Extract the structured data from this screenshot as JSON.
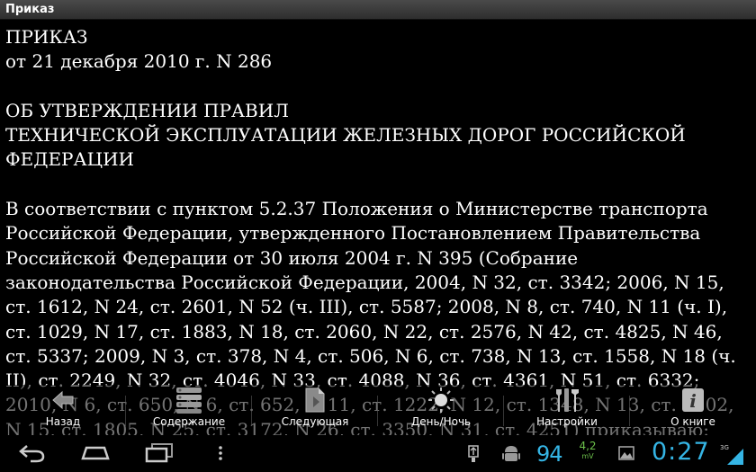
{
  "window": {
    "title": "Приказ"
  },
  "document": {
    "heading1": "ПРИКАЗ",
    "heading2": "от 21 декабря 2010 г. N 286",
    "title_line1": "ОБ УТВЕРЖДЕНИИ ПРАВИЛ",
    "title_line2": "ТЕХНИЧЕСКОЙ ЭКСПЛУАТАЦИИ ЖЕЛЕЗНЫХ ДОРОГ РОССИЙСКОЙ",
    "title_line3": "ФЕДЕРАЦИИ",
    "body": "В соответствии с пунктом 5.2.37 Положения о Министерстве транспорта Российской Федерации, утвержденного Постановлением Правительства Российской Федерации от 30 июля 2004 г. N 395 (Собрание законодательства Российской Федерации, 2004, N 32, ст. 3342; 2006, N 15, ст. 1612, N 24, ст. 2601, N 52 (ч. III), ст. 5587; 2008, N 8, ст. 740, N 11 (ч. I), ст. 1029, N 17, ст. 1883, N 18, ст. 2060, N 22, ст. 2576, N 42, ст. 4825, N 46, ст. 5337; 2009, N 3, ст. 378, N 4, ст. 506, N 6, ст. 738, N 13, ст. 1558, N 18 (ч. II), ст. 2249, N 32, ст. 4046, N 33, ст. 4088, N 36, ст. 4361, N 51, ст. 6332; 2010, N 6, ст. 650, N 6, ст. 652, N 11, ст. 1222, N 12, ст. 1348, N 13, ст. 1502, N 15, ст. 1805, N 25, ст. 3172, N 26, ст. 3350, N 31, ст. 4251) приказываю:"
  },
  "actions": [
    {
      "label": "Назад",
      "icon": "back-icon"
    },
    {
      "label": "Содержание",
      "icon": "contents-icon"
    },
    {
      "label": "Следующая",
      "icon": "next-page-icon"
    },
    {
      "label": "День/Ночь",
      "icon": "day-night-icon"
    },
    {
      "label": "Настройки",
      "icon": "settings-icon"
    },
    {
      "label": "О книге",
      "icon": "info-icon"
    }
  ],
  "status": {
    "battery": "94",
    "voltage": "4,2",
    "voltage_unit": "mV",
    "time": "0:27",
    "network": "3G"
  },
  "colors": {
    "accent": "#35b5e5",
    "voltage": "#6cc04a"
  }
}
